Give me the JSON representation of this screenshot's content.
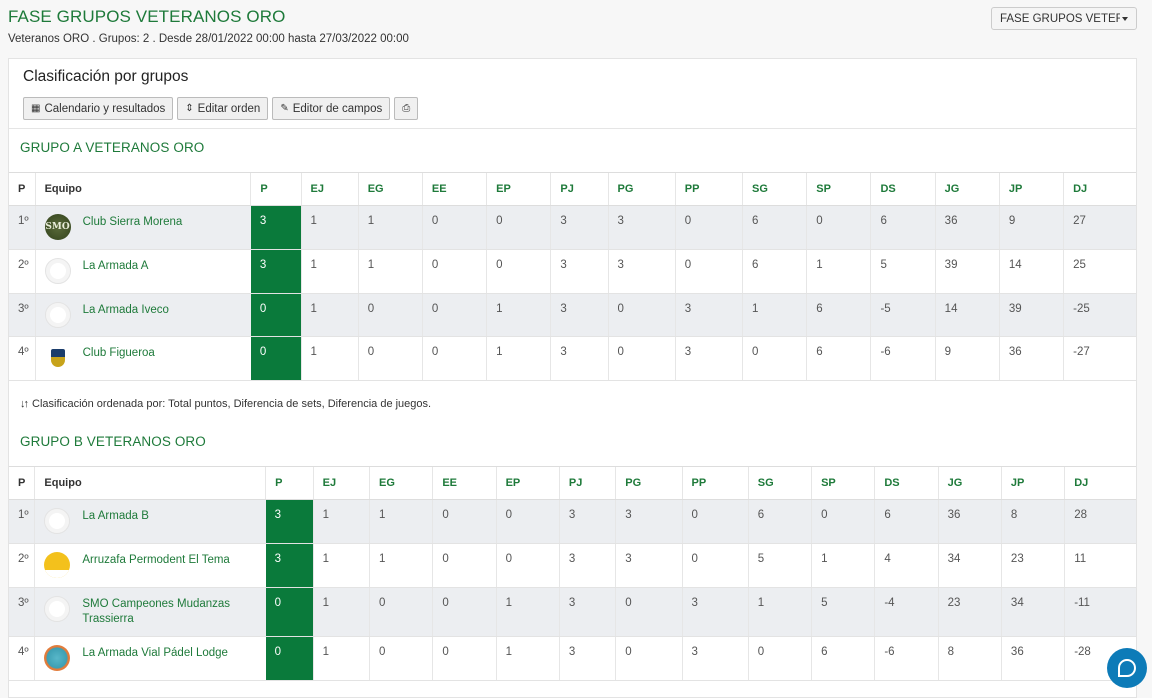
{
  "header": {
    "title": "FASE GRUPOS VETERANOS ORO",
    "subtitle": "Veteranos ORO . Grupos: 2 . Desde 28/01/2022 00:00 hasta 27/03/2022 00:00",
    "phase_select_value": "FASE GRUPOS VETERANOS ORO"
  },
  "panel": {
    "title": "Clasificación por grupos",
    "buttons": {
      "calendar": "Calendario y resultados",
      "edit_order": "Editar orden",
      "field_editor": "Editor de campos"
    },
    "sort_note": "Clasificación ordenada por: Total puntos, Diferencia de sets, Diferencia de juegos."
  },
  "columns": [
    "P",
    "Equipo",
    "P",
    "EJ",
    "EG",
    "EE",
    "EP",
    "PJ",
    "PG",
    "PP",
    "SG",
    "SP",
    "DS",
    "JG",
    "JP",
    "DJ"
  ],
  "groups": [
    {
      "title": "GRUPO A VETERANOS ORO",
      "rows": [
        {
          "pos": "1º",
          "team": "Club Sierra Morena",
          "logo": "smo-logo",
          "p": "3",
          "ej": "1",
          "eg": "1",
          "ee": "0",
          "ep": "0",
          "pj": "3",
          "pg": "3",
          "pp": "0",
          "sg": "6",
          "sp": "0",
          "ds": "6",
          "jg": "36",
          "jp": "9",
          "dj": "27"
        },
        {
          "pos": "2º",
          "team": "La Armada A",
          "logo": "blank-logo",
          "p": "3",
          "ej": "1",
          "eg": "1",
          "ee": "0",
          "ep": "0",
          "pj": "3",
          "pg": "3",
          "pp": "0",
          "sg": "6",
          "sp": "1",
          "ds": "5",
          "jg": "39",
          "jp": "14",
          "dj": "25"
        },
        {
          "pos": "3º",
          "team": "La Armada Iveco",
          "logo": "blank-logo",
          "p": "0",
          "ej": "1",
          "eg": "0",
          "ee": "0",
          "ep": "1",
          "pj": "3",
          "pg": "0",
          "pp": "3",
          "sg": "1",
          "sp": "6",
          "ds": "-5",
          "jg": "14",
          "jp": "39",
          "dj": "-25"
        },
        {
          "pos": "4º",
          "team": "Club Figueroa",
          "logo": "figueroa-logo",
          "p": "0",
          "ej": "1",
          "eg": "0",
          "ee": "0",
          "ep": "1",
          "pj": "3",
          "pg": "0",
          "pp": "3",
          "sg": "0",
          "sp": "6",
          "ds": "-6",
          "jg": "9",
          "jp": "36",
          "dj": "-27"
        }
      ]
    },
    {
      "title": "GRUPO B VETERANOS ORO",
      "rows": [
        {
          "pos": "1º",
          "team": "La Armada B",
          "logo": "blank-logo",
          "p": "3",
          "ej": "1",
          "eg": "1",
          "ee": "0",
          "ep": "0",
          "pj": "3",
          "pg": "3",
          "pp": "0",
          "sg": "6",
          "sp": "0",
          "ds": "6",
          "jg": "36",
          "jp": "8",
          "dj": "28"
        },
        {
          "pos": "2º",
          "team": "Arruzafa Permodent El Tema",
          "logo": "arruzafa-logo",
          "p": "3",
          "ej": "1",
          "eg": "1",
          "ee": "0",
          "ep": "0",
          "pj": "3",
          "pg": "3",
          "pp": "0",
          "sg": "5",
          "sp": "1",
          "ds": "4",
          "jg": "34",
          "jp": "23",
          "dj": "11"
        },
        {
          "pos": "3º",
          "team": "SMO Campeones Mudanzas Trassierra",
          "logo": "blank-logo",
          "p": "0",
          "ej": "1",
          "eg": "0",
          "ee": "0",
          "ep": "1",
          "pj": "3",
          "pg": "0",
          "pp": "3",
          "sg": "1",
          "sp": "5",
          "ds": "-4",
          "jg": "23",
          "jp": "34",
          "dj": "-11"
        },
        {
          "pos": "4º",
          "team": "La Armada Vial Pádel Lodge",
          "logo": "vial-logo",
          "p": "0",
          "ej": "1",
          "eg": "0",
          "ee": "0",
          "ep": "1",
          "pj": "3",
          "pg": "0",
          "pp": "3",
          "sg": "0",
          "sp": "6",
          "ds": "-6",
          "jg": "8",
          "jp": "36",
          "dj": "-28"
        }
      ]
    }
  ],
  "icons": {
    "calendar": "calendar-icon",
    "sort": "sort-icon",
    "edit": "pencil-icon",
    "print": "print-icon",
    "chat": "chat-icon"
  },
  "colors": {
    "accent_green": "#1e7a3a",
    "points_cell": "#0a7a3b",
    "chat_button": "#0d7bb8"
  }
}
